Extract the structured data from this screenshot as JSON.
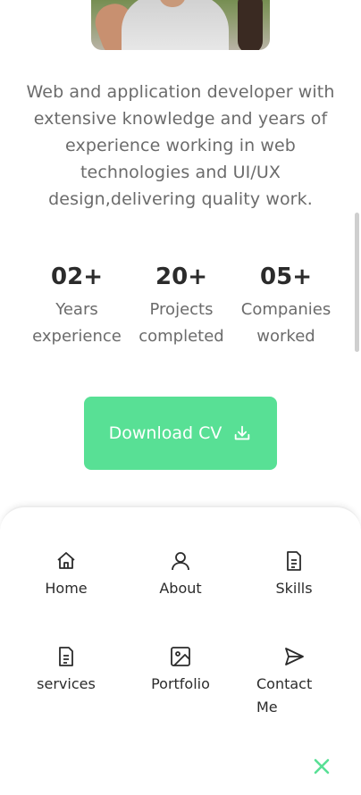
{
  "bio": "Web and application developer with extensive knowledge and years of experience working in web technologies and UI/UX design,delivering quality work.",
  "stats": [
    {
      "value": "02+",
      "label": "Years\nexperience"
    },
    {
      "value": "20+",
      "label": "Projects\ncompleted"
    },
    {
      "value": "05+",
      "label": "Companies\nworked"
    }
  ],
  "cv_button": {
    "label": "Download CV",
    "icon": "download-icon"
  },
  "menu": {
    "items": [
      {
        "label": "Home",
        "icon": "home-icon"
      },
      {
        "label": "About",
        "icon": "user-icon"
      },
      {
        "label": "Skills",
        "icon": "file-icon"
      },
      {
        "label": "services",
        "icon": "file-icon"
      },
      {
        "label": "Portfolio",
        "icon": "image-icon"
      },
      {
        "label": "Contact\nMe",
        "icon": "send-icon"
      }
    ],
    "close_icon": "close-icon"
  },
  "colors": {
    "accent": "#58e095",
    "text": "#2b2b2b",
    "muted": "#6b6b6b"
  }
}
